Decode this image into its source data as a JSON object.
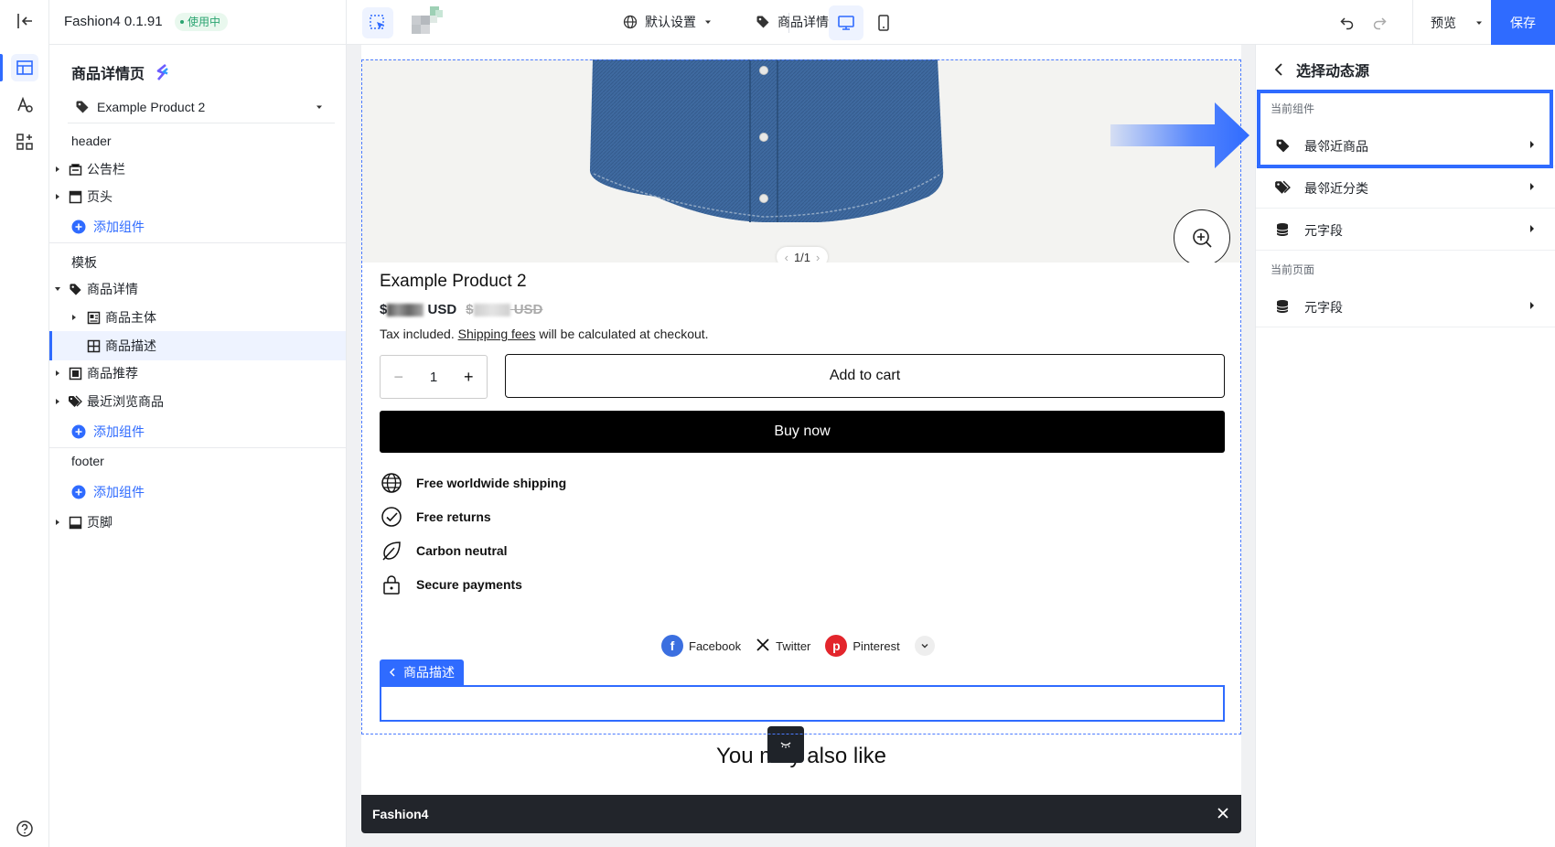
{
  "app": {
    "name": "Fashion4 0.1.91",
    "status": "使用中"
  },
  "toolbar": {
    "default_settings": "默认设置",
    "page_template": "商品详情页",
    "preview": "预览",
    "save": "保存"
  },
  "left_panel": {
    "title": "商品详情页",
    "product_select": "Example Product 2",
    "sections": {
      "header": "header",
      "template": "模板",
      "footer": "footer"
    },
    "header_items": [
      "公告栏",
      "页头"
    ],
    "template_items": {
      "product_detail": "商品详情",
      "product_main": "商品主体",
      "product_desc": "商品描述",
      "recommend": "商品推荐",
      "recent": "最近浏览商品"
    },
    "footer_items": [
      "页脚"
    ],
    "add_component": "添加组件"
  },
  "preview": {
    "pager": "1/1",
    "product_title": "Example Product 2",
    "price_currency": "USD",
    "compare_currency": "USD",
    "price_symbol": "$",
    "tax_prefix": "Tax included.",
    "shipping_link": "Shipping fees",
    "tax_suffix": "will be calculated at checkout.",
    "quantity": "1",
    "add_to_cart": "Add to cart",
    "buy_now": "Buy now",
    "features": [
      "Free worldwide shipping",
      "Free returns",
      "Carbon neutral",
      "Secure payments"
    ],
    "share": [
      "Facebook",
      "Twitter",
      "Pinterest"
    ],
    "desc_tag": "商品描述",
    "also_like": "You may also like",
    "bottom_bar": "Fashion4"
  },
  "right_panel": {
    "title": "选择动态源",
    "group_current_component": "当前组件",
    "group_current_page": "当前页面",
    "items_component": [
      "最邻近商品",
      "最邻近分类",
      "元字段"
    ],
    "items_page": [
      "元字段"
    ]
  },
  "colors": {
    "accent": "#2f6bff",
    "status_green": "#2ba471",
    "bottom_bar": "#22252b"
  }
}
